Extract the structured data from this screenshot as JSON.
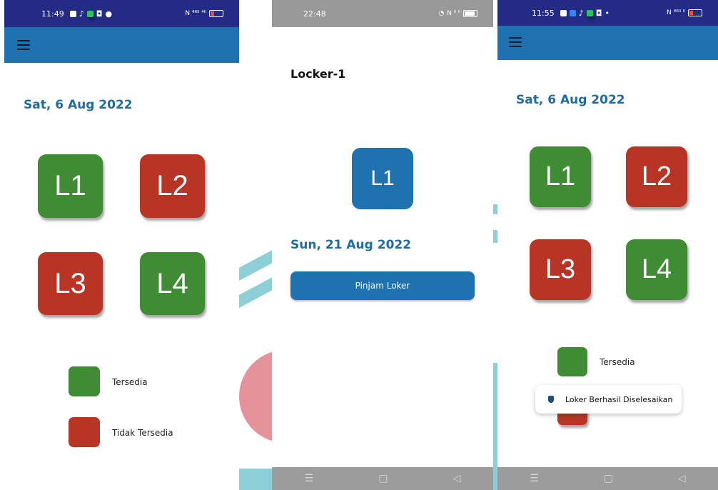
{
  "screen1": {
    "status": {
      "time": "11:49",
      "right": "N  ⁴⁶ᴵˡ ⁴ᴵˡ"
    },
    "date": "Sat, 6 Aug 2022",
    "lockers": [
      {
        "label": "L1",
        "status": "Tersedia"
      },
      {
        "label": "L2",
        "status": "Tidak Tersedia"
      },
      {
        "label": "L3",
        "status": "Tidak Tersedia"
      },
      {
        "label": "L4",
        "status": "Tersedia"
      }
    ],
    "legend": [
      {
        "label": "Tersedia"
      },
      {
        "label": "Tidak Tersedia"
      }
    ]
  },
  "screen2": {
    "status": {
      "time": "22:48",
      "right": "N  ᴵˡ ᴵˡ"
    },
    "title": "Locker-1",
    "locker": "L1",
    "date": "Sun, 21 Aug 2022",
    "button": "Pinjam Loker",
    "nav": [
      "☰",
      "▢",
      "◁"
    ]
  },
  "screen3": {
    "status": {
      "time": "11:55",
      "right": "N  ⁴⁶ᴵˡ ᴵˡ"
    },
    "date": "Sat, 6 Aug 2022",
    "lockers": [
      "L1",
      "L2",
      "L3",
      "L4"
    ],
    "legend": [
      {
        "label": "Tersedia"
      }
    ],
    "toast": "Loker Berhasil Diselesaikan",
    "nav": [
      "☰",
      "▢",
      "◁"
    ]
  },
  "colors": {
    "primary": "#1f72b0",
    "available": "#3f8c34",
    "unavailable": "#b83525",
    "statusbar": "#232b84"
  }
}
